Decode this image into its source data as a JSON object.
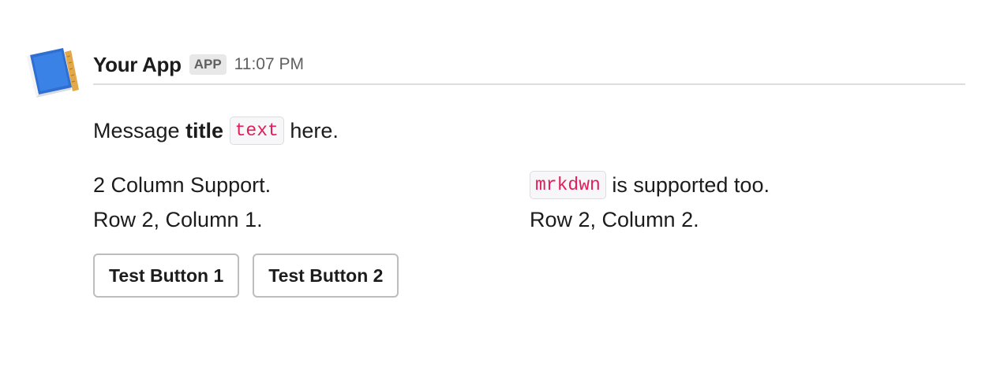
{
  "message": {
    "app_name": "Your App",
    "badge": "APP",
    "timestamp": "11:07 PM",
    "avatar_icon": "app-book-icon",
    "title_parts": {
      "lead": "Message ",
      "bold": "title",
      "code": "text",
      "tail": " here."
    },
    "fields": [
      {
        "text": "2 Column Support."
      },
      {
        "code": "mrkdwn",
        "text": " is supported too."
      },
      {
        "text": "Row 2, Column 1."
      },
      {
        "text": "Row 2, Column 2."
      }
    ],
    "buttons": [
      {
        "label": "Test Button 1"
      },
      {
        "label": "Test Button 2"
      }
    ]
  },
  "colors": {
    "code_text": "#e01e5a",
    "code_bg": "#f7f7f9",
    "muted": "#616061",
    "text": "#1d1c1d"
  }
}
